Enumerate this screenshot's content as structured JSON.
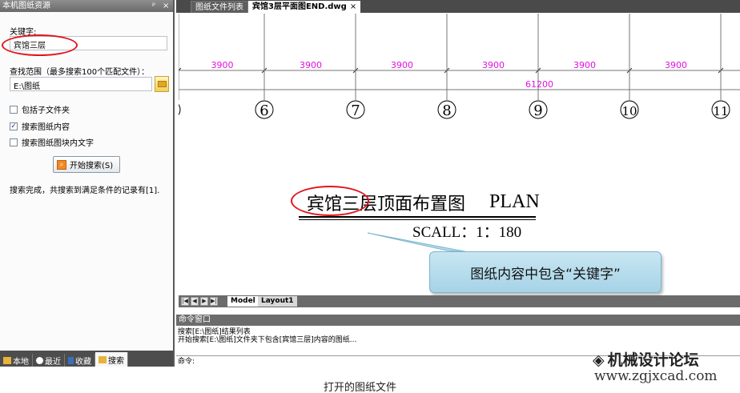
{
  "left_panel": {
    "title": "本机图纸资源",
    "pin_icon": "pin-icon",
    "close_icon": "close-icon",
    "keyword_label": "关键字:",
    "keyword_value": "宾馆三层",
    "scope_label": "查找范围（最多搜索100个匹配文件）：",
    "scope_value": "E:\\图纸",
    "options": [
      {
        "label": "包括子文件夹",
        "checked": false
      },
      {
        "label": "搜索图纸内容",
        "checked": true
      },
      {
        "label": "搜索图纸图块内文字",
        "checked": false
      }
    ],
    "search_button": "开始搜索(S)",
    "result_text": "搜索完成，共搜索到满足条件的记录有[1].",
    "tabs": [
      {
        "label": "本地",
        "icon": "folder-icon",
        "active": false
      },
      {
        "label": "最近",
        "icon": "clock-icon",
        "active": false
      },
      {
        "label": "收藏",
        "icon": "book-icon",
        "active": false
      },
      {
        "label": "搜索",
        "icon": "folder-search-icon",
        "active": true
      }
    ]
  },
  "document_tabs": {
    "list_tab": "图纸文件列表",
    "active_tab": "宾馆3层平面图END.dwg",
    "close_glyph": "×"
  },
  "drawing": {
    "dimensions": [
      "3900",
      "3900",
      "3900",
      "3900",
      "3900",
      "3900"
    ],
    "total_dimension": "61200",
    "grid_axes": [
      "6",
      "7",
      "8",
      "9",
      "10",
      "11"
    ],
    "title_cn": "宾馆三层顶面布置图",
    "title_en": "PLAN",
    "scale": "SCALL：1：180",
    "callout": "图纸内容中包含“关键字”",
    "colors": {
      "dimension": "#e010e0",
      "annotation_red": "#e0151b",
      "callout_bg": "#b5dcec"
    }
  },
  "layout_tabs": {
    "nav_buttons": [
      "|◀",
      "◀",
      "▶",
      "▶|"
    ],
    "model": "Model",
    "layout1": "Layout1"
  },
  "command_window": {
    "title": "命令窗口",
    "lines": [
      "搜索[E:\\图纸]结果列表",
      "开始搜索[E:\\图纸]文件夹下包含[宾馆三层]内容的图纸..."
    ],
    "prompt": "命令:"
  },
  "watermark": {
    "name": "机械设计论坛",
    "url": "www.zgjxcad.com"
  },
  "caption": "打开的图纸文件"
}
